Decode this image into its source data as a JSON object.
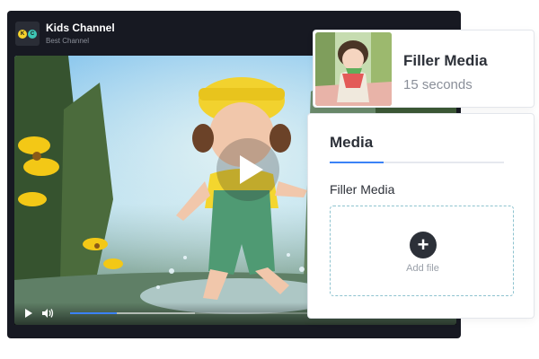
{
  "channel": {
    "logo_letters": [
      "K",
      "C"
    ],
    "name": "Kids Channel",
    "subtitle": "Best Channel"
  },
  "player": {
    "icons": {
      "center": "play-icon",
      "play": "play-icon",
      "volume": "volume-icon"
    },
    "progress_fraction": 0.18,
    "buffered_fraction": 0.48,
    "accent_color": "#3b82f6"
  },
  "filler_card": {
    "title": "Filler Media",
    "duration": "15 seconds"
  },
  "media_panel": {
    "tab_label": "Media",
    "field_label": "Filler Media",
    "dropzone": {
      "icon": "plus-icon",
      "icon_glyph": "+",
      "label": "Add file"
    }
  },
  "colors": {
    "accent": "#3b82f6",
    "player_bg": "#171922",
    "dropzone_border": "#8ec3cf"
  }
}
